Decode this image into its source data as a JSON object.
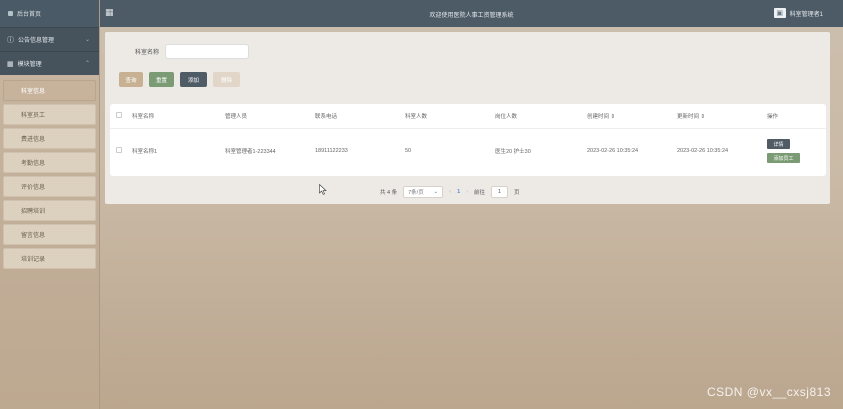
{
  "sidebar": {
    "home_label": "后台首页",
    "groups": [
      {
        "label": "公告信息管理",
        "chevron": "⌄"
      },
      {
        "label": "模块管理",
        "chevron": "⌃"
      }
    ],
    "items": [
      {
        "label": "科室信息",
        "active": true
      },
      {
        "label": "科室员工",
        "active": false
      },
      {
        "label": "费进信息",
        "active": false
      },
      {
        "label": "考勤信息",
        "active": false
      },
      {
        "label": "评价信息",
        "active": false
      },
      {
        "label": "招聘培训",
        "active": false
      },
      {
        "label": "留言信息",
        "active": false
      },
      {
        "label": "培训记录",
        "active": false
      }
    ]
  },
  "header": {
    "title": "欢迎使用医院人事工资管理系统",
    "user_label": "科室管理者1"
  },
  "search": {
    "label": "科室名称",
    "value": ""
  },
  "toolbar": {
    "search_label": "查询",
    "reset_label": "重置",
    "add_label": "添加",
    "delete_label": "删除"
  },
  "table": {
    "columns": [
      "科室名称",
      "管理人员",
      "联系电话",
      "科室人数",
      "岗位人数",
      "创建时间 ⇕",
      "更新时间 ⇕",
      "操作"
    ],
    "rows": [
      {
        "name": "科室名称1",
        "manager": "科室管理者1-223344",
        "phone": "18911122233",
        "count": "50",
        "positions": "医生20 护士30",
        "created": "2023-02-26 10:35:24",
        "updated": "2023-02-26 10:35:24",
        "op_detail": "详情",
        "op_add_staff": "添加员工"
      }
    ]
  },
  "pagination": {
    "total_text": "共 4 条",
    "page_size": "7条/页",
    "prev": "‹",
    "current": "1",
    "next": "›",
    "goto_label": "前往",
    "goto_value": "1",
    "page_suffix": "页"
  },
  "watermark": "CSDN @vx__cxsj813",
  "colors": {
    "header": "#4d5b66",
    "accent_green": "#7a9b73",
    "accent_tan": "#c8b193",
    "page_link": "#5b8ed6"
  }
}
